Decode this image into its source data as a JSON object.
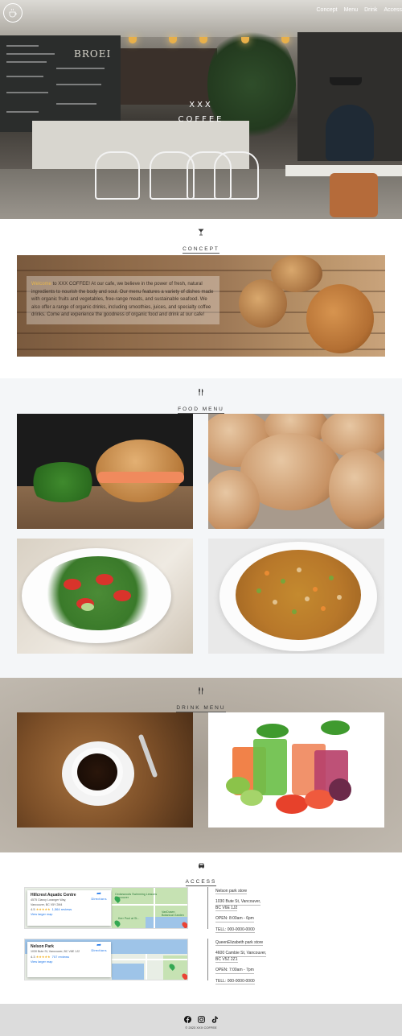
{
  "hero": {
    "brand_line1": "XXX",
    "brand_line2": "COFFEE",
    "sign_text": "BROEI"
  },
  "nav": {
    "items": [
      "Concept",
      "Menu",
      "Drink",
      "Access"
    ]
  },
  "concept": {
    "title": "CONCEPT",
    "icon": "cocktail-glass-icon",
    "highlight": "Welcome",
    "text": " to XXX COFFEE! At our cafe, we believe in the power of fresh, natural ingredients to nourish the body and soul. Our menu features a variety of dishes made with organic fruits and vegetables, free-range meats, and sustainable seafood. We also offer a range of organic drinks, including smoothies, juices, and specialty coffee drinks. Come and experience the goodness of organic food and drink at our cafe!"
  },
  "food_menu": {
    "title": "FOOD MENU",
    "icon": "fork-knife-icon"
  },
  "drink_menu": {
    "title": "DRINK MENU",
    "icon": "fork-knife-icon"
  },
  "access": {
    "title": "ACCESS",
    "icon": "car-icon",
    "maps": [
      {
        "name": "Hillcrest Aquatic Centre",
        "address_line1": "4575 Clancy Loranger Way,",
        "address_line2": "Vancouver, BC V5Y 2M4",
        "rating": "4.5",
        "stars": "★★★★★",
        "reviews": "1,564 reviews",
        "directions": "Directions",
        "larger_map": "View larger map",
        "place_labels": [
          "Cedarwoods Swimming Lessons Vancouver",
          "Kerr Pool at St...",
          "VanDusen Botanical Garden"
        ]
      },
      {
        "name": "Nelson Park",
        "address_line1": "1030 Bute St, Vancouver, BC V6E 1J2",
        "address_line2": "",
        "rating": "4.3",
        "stars": "★★★★★",
        "reviews": "707 reviews",
        "directions": "Directions",
        "larger_map": "View larger map",
        "place_labels": []
      }
    ],
    "stores": [
      {
        "name": "Nelson park store",
        "address_line1": "1030 Bute St, Vancouver,",
        "address_line2": "BC V6E 1J2",
        "open": "OPEN: 8:00am - 6pm",
        "tel": "TELL: 000-0000-0000"
      },
      {
        "name": "QueenElizabeth park store",
        "address_line1": "4600 Cambie St, Vancouver,",
        "address_line2": "BC V5Z 2Z1",
        "open": "OPEN: 7:00am - 7pm",
        "tel": "TELL: 000-0000-0000"
      }
    ]
  },
  "footer": {
    "social": [
      "facebook-icon",
      "instagram-icon",
      "tiktok-icon"
    ],
    "copyright": "© 2023 XXX COFFEE"
  },
  "colors": {
    "accent": "#e7b64b",
    "footer_bg": "#dcdcdc",
    "drink_bg": "#b2aa9f",
    "link": "#1a73e8"
  }
}
